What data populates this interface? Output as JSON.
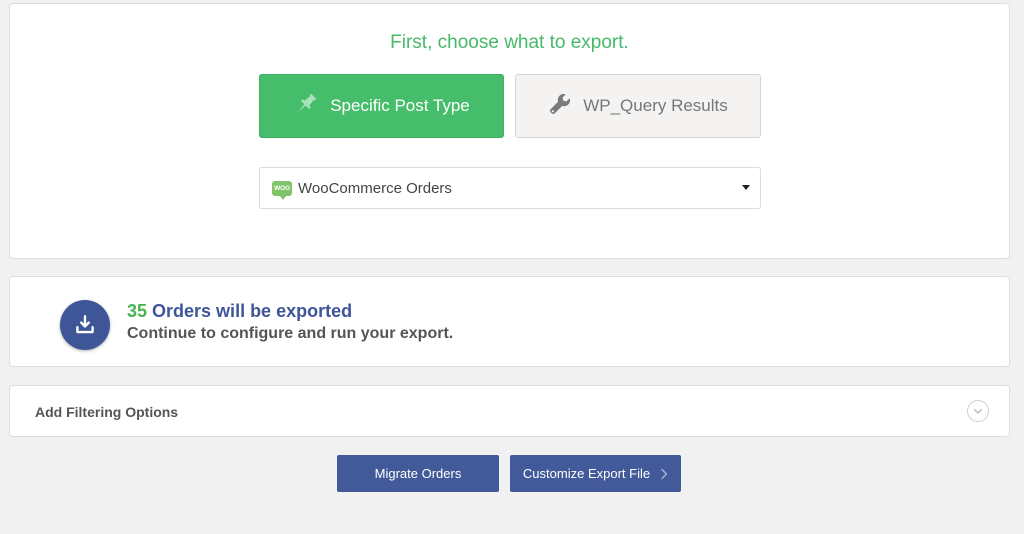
{
  "choose": {
    "headline": "First, choose what to export.",
    "specific_post_type_label": "Specific Post Type",
    "wp_query_label": "WP_Query Results",
    "post_type_select": {
      "selected": "WooCommerce Orders",
      "logo_text": "WOO"
    }
  },
  "summary": {
    "count": "35",
    "line1_suffix": " Orders will be exported",
    "line2": "Continue to configure and run your export."
  },
  "filter": {
    "label": "Add Filtering Options"
  },
  "actions": {
    "migrate_label": "Migrate Orders",
    "customize_label": "Customize Export File"
  },
  "colors": {
    "accent_green": "#46bd6a",
    "primary_blue": "#425a9a",
    "background": "#f1f1f1"
  },
  "icons": {
    "specific_post_type": "pin-icon",
    "wp_query": "wrench-icon",
    "export": "download-tray-icon",
    "filter_toggle": "chevron-down-circle-icon",
    "customize_arrow": "chevron-right-icon"
  }
}
